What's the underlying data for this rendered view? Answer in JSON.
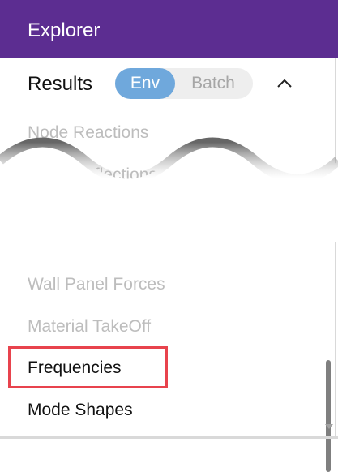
{
  "header": {
    "title": "Explorer"
  },
  "results": {
    "label": "Results",
    "toggle": {
      "options": [
        "Env",
        "Batch"
      ],
      "selected": "Env"
    }
  },
  "items": [
    {
      "label": "Node Reactions"
    },
    {
      "label": "Node Deflections"
    },
    {
      "label": "Wall Panel Forces"
    },
    {
      "label": "Material TakeOff"
    },
    {
      "label": "Frequencies"
    },
    {
      "label": "Mode Shapes"
    }
  ],
  "icons": {
    "collapse": "chevron-up-icon"
  },
  "colors": {
    "header_bg": "#5c2d91",
    "toggle_active": "#6fa8dc",
    "highlight": "#e8434d"
  }
}
